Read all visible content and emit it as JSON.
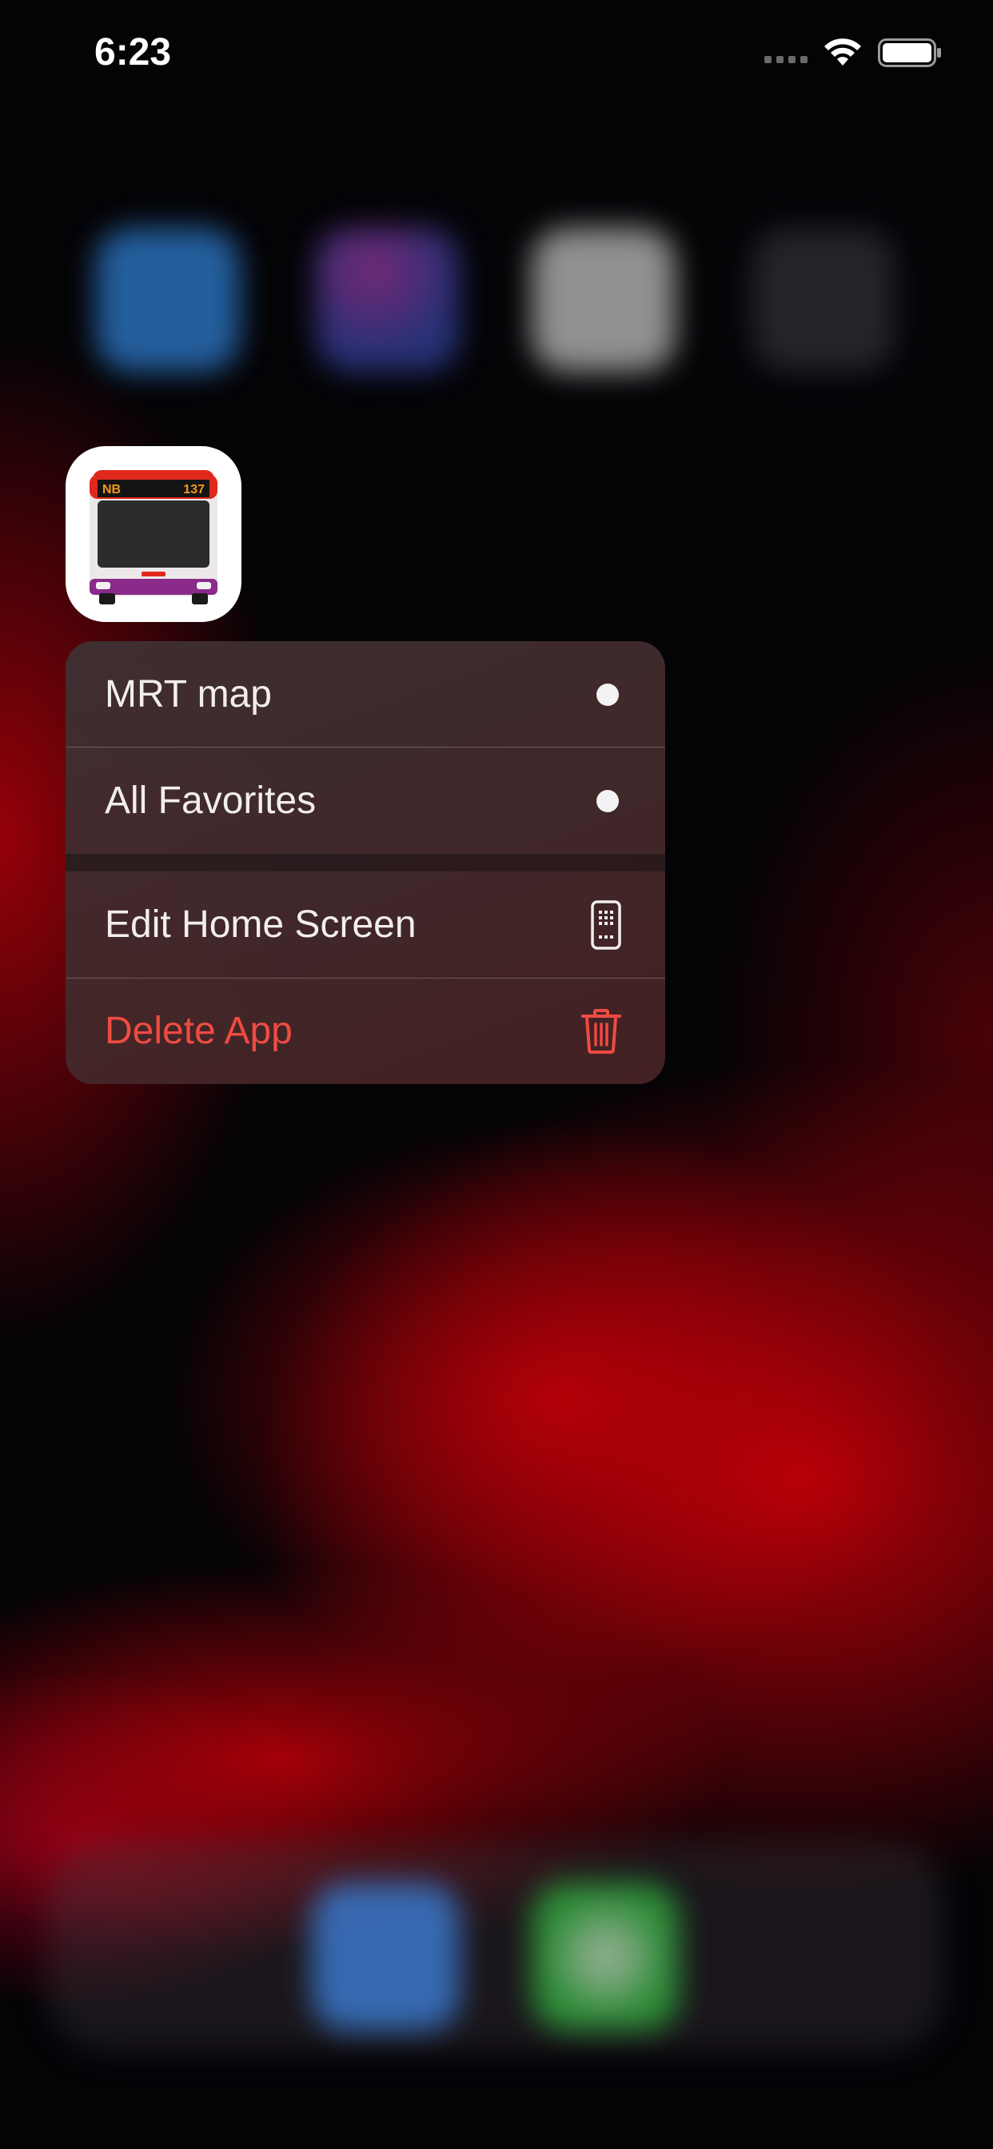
{
  "status_bar": {
    "time": "6:23"
  },
  "app": {
    "icon_text_left": "NB",
    "icon_text_right": "137"
  },
  "menu": {
    "items": [
      {
        "label": "MRT map",
        "icon": "dot-icon"
      },
      {
        "label": "All Favorites",
        "icon": "dot-icon"
      },
      {
        "label": "Edit Home Screen",
        "icon": "phone-apps-icon"
      },
      {
        "label": "Delete App",
        "icon": "trash-icon",
        "color": "#ef4b42"
      }
    ]
  },
  "colors": {
    "destructive": "#ef4b42",
    "wallpaper_red": "#c0000a"
  }
}
